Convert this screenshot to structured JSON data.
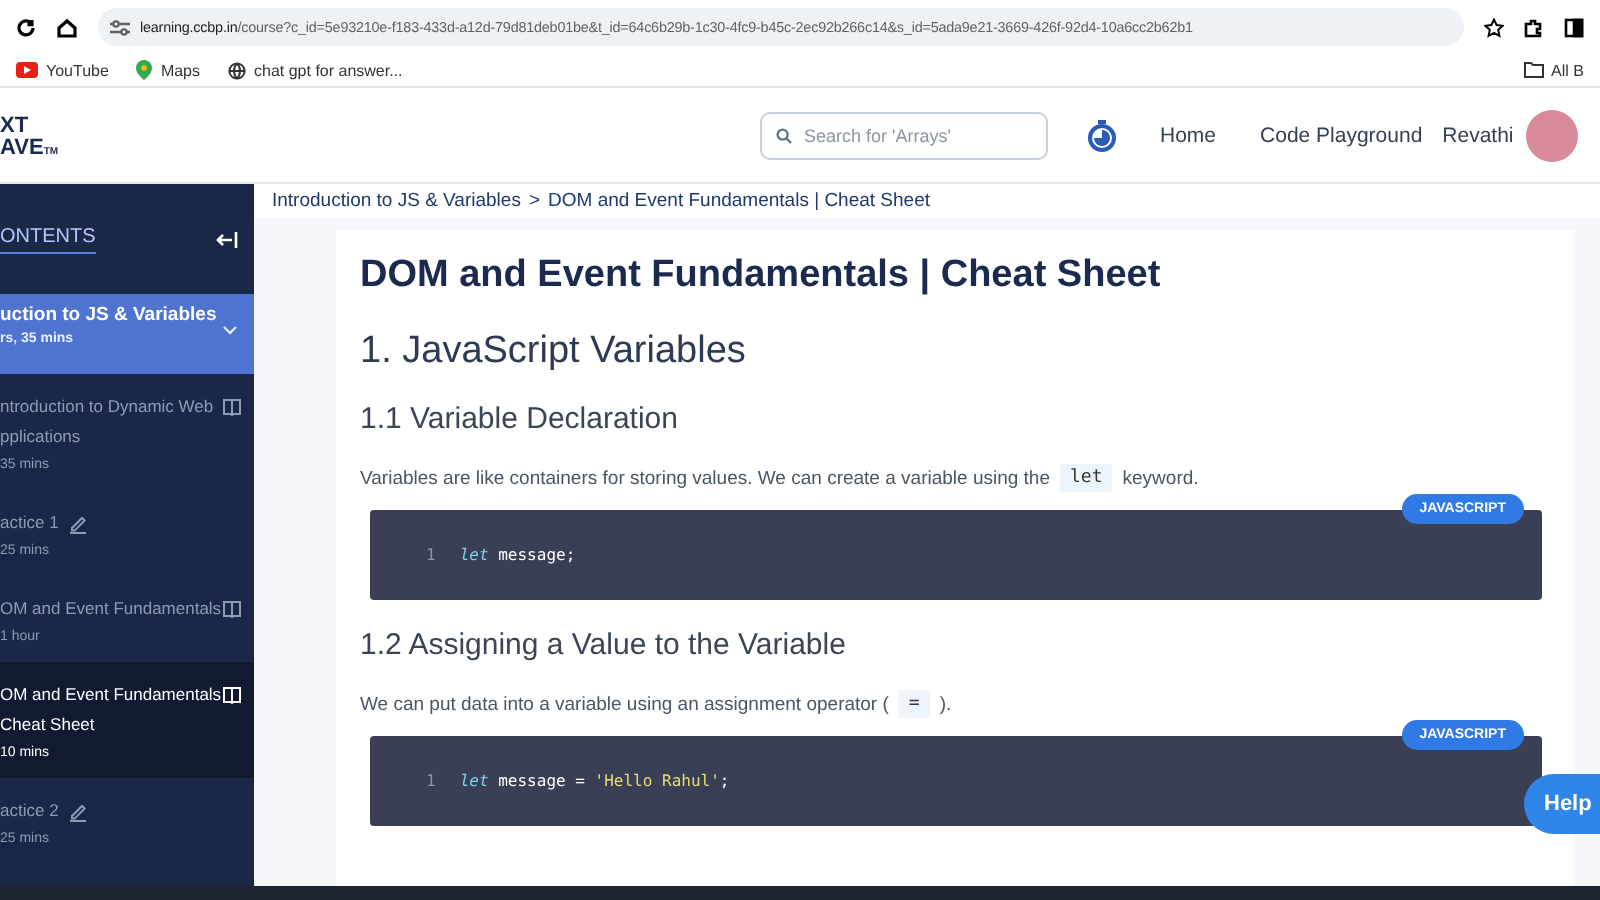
{
  "browser": {
    "url_host": "learning.ccbp.in",
    "url_path": "/course?c_id=5e93210e-f183-433d-a12d-79d81deb01be&t_id=64c6b29b-1c30-4fc9-b45c-2ec92b266c14&s_id=5ada9e21-3669-426f-92d4-10a6cc2b62b1",
    "bookmarks": [
      {
        "label": "YouTube",
        "kind": "youtube"
      },
      {
        "label": "Maps",
        "kind": "maps"
      },
      {
        "label": "chat gpt for answer...",
        "kind": "globe"
      }
    ],
    "all_bookmarks": "All B"
  },
  "header": {
    "logo_top": "XT",
    "logo_bottom": "AVE",
    "logo_mark": "TM",
    "search": {
      "placeholder": "Search for 'Arrays'"
    },
    "nav": [
      "Home",
      "Code Playground"
    ],
    "user": "Revathi"
  },
  "sidebar": {
    "title": "ONTENTS",
    "module": {
      "title": "uction to JS & Variables",
      "duration": "rs, 35 mins",
      "expanded": true
    },
    "items": [
      {
        "lines": [
          "ntroduction to Dynamic Web",
          "pplications"
        ],
        "duration": "35 mins",
        "kind": "reading",
        "selected": false
      },
      {
        "lines": [
          "actice 1"
        ],
        "duration": "25 mins",
        "kind": "practice",
        "selected": false
      },
      {
        "lines": [
          "OM and Event Fundamentals"
        ],
        "duration": "1 hour",
        "kind": "reading",
        "selected": false
      },
      {
        "lines": [
          "OM and Event Fundamentals",
          "Cheat Sheet"
        ],
        "duration": "10 mins",
        "kind": "reading",
        "selected": true
      },
      {
        "lines": [
          "actice 2"
        ],
        "duration": "25 mins",
        "kind": "practice",
        "selected": false
      }
    ]
  },
  "breadcrumb": {
    "items": [
      "Introduction to JS & Variables",
      "DOM and Event Fundamentals | Cheat Sheet"
    ],
    "separator": ">"
  },
  "content": [
    {
      "kind": "title",
      "text": "DOM and Event Fundamentals | Cheat Sheet"
    },
    {
      "kind": "h2",
      "text": "1. JavaScript Variables"
    },
    {
      "kind": "h3",
      "text": "1.1 Variable Declaration"
    },
    {
      "kind": "para",
      "before": "Variables are like containers for storing values. We can create a variable using the",
      "code": "let",
      "after": "keyword."
    },
    {
      "kind": "code",
      "language": "JAVASCRIPT",
      "line_number": "1",
      "keyword": "let",
      "rest": "message",
      "end": ";"
    },
    {
      "kind": "h3",
      "text": "1.2 Assigning a Value to the Variable"
    },
    {
      "kind": "para",
      "before": "We can put data into a variable using an assignment operator (",
      "code": "=",
      "after": ")."
    },
    {
      "kind": "code",
      "language": "JAVASCRIPT",
      "line_number": "1",
      "keyword": "let",
      "rest": "message",
      "operator": "=",
      "string": "'Hello Rahul'",
      "end": ";"
    }
  ],
  "help": "Help"
}
